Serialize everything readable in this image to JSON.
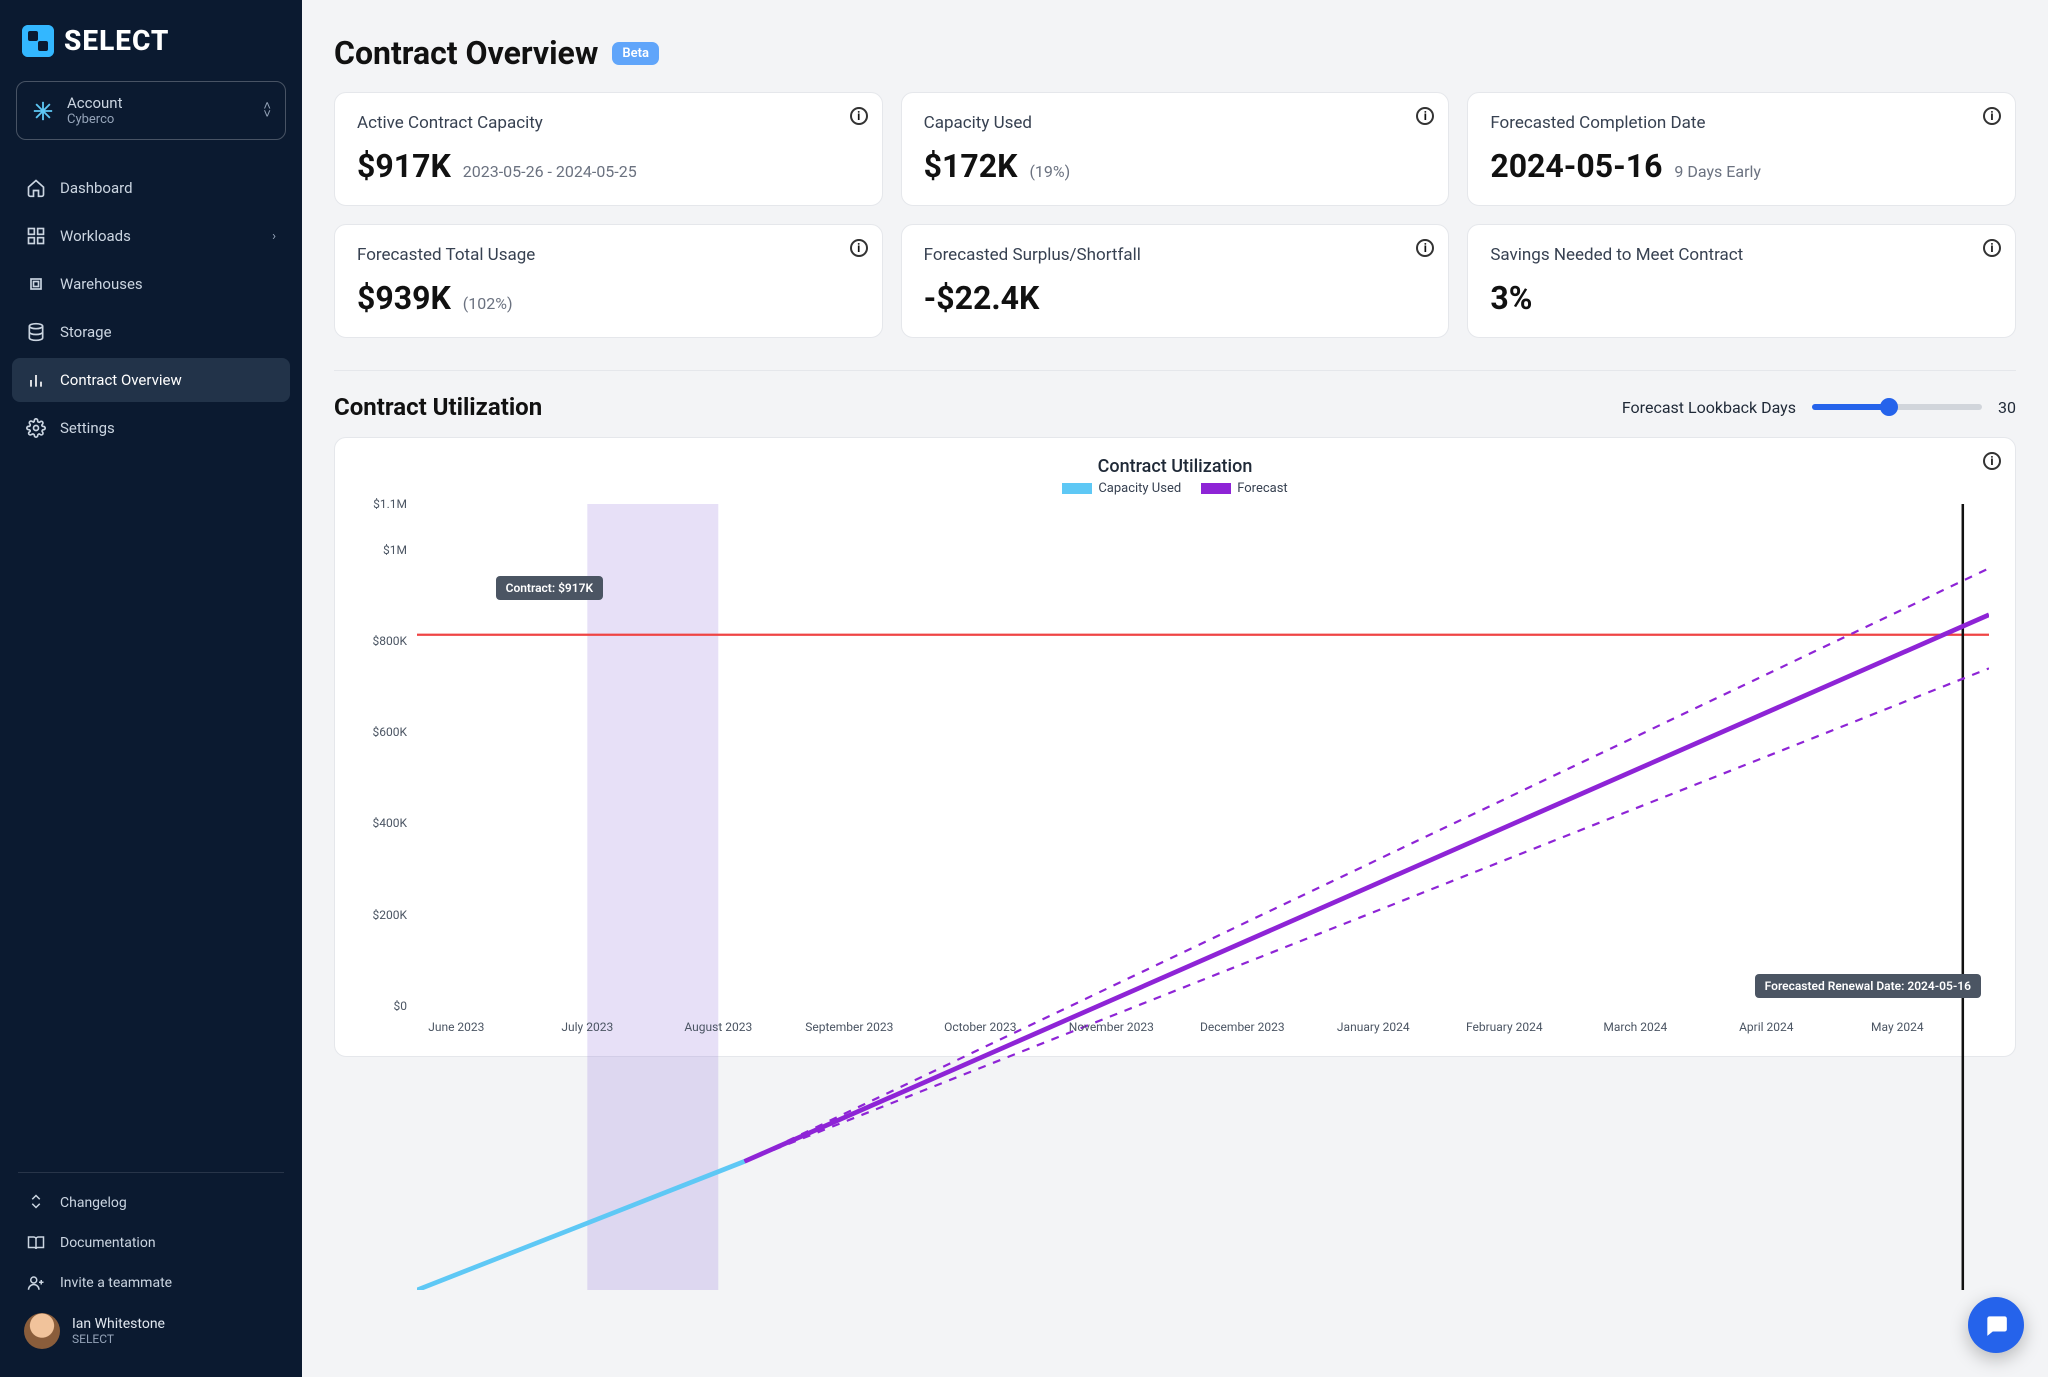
{
  "brand": "SELECT",
  "account": {
    "label": "Account",
    "name": "Cyberco"
  },
  "nav": {
    "dashboard": "Dashboard",
    "workloads": "Workloads",
    "warehouses": "Warehouses",
    "storage": "Storage",
    "contract_overview": "Contract Overview",
    "settings": "Settings"
  },
  "bottom_nav": {
    "changelog": "Changelog",
    "documentation": "Documentation",
    "invite": "Invite a teammate"
  },
  "user": {
    "name": "Ian Whitestone",
    "org": "SELECT"
  },
  "page": {
    "title": "Contract Overview",
    "badge": "Beta"
  },
  "cards": {
    "active_capacity": {
      "title": "Active Contract Capacity",
      "value": "$917K",
      "sub": "2023-05-26 - 2024-05-25"
    },
    "capacity_used": {
      "title": "Capacity Used",
      "value": "$172K",
      "sub": "(19%)"
    },
    "forecasted_completion": {
      "title": "Forecasted Completion Date",
      "value": "2024-05-16",
      "sub": "9 Days Early"
    },
    "forecasted_total": {
      "title": "Forecasted Total Usage",
      "value": "$939K",
      "sub": "(102%)"
    },
    "surplus": {
      "title": "Forecasted Surplus/Shortfall",
      "value": "-$22.4K"
    },
    "savings": {
      "title": "Savings Needed to Meet Contract",
      "value": "3%"
    }
  },
  "utilization": {
    "title": "Contract Utilization",
    "lookback_label": "Forecast Lookback Days",
    "lookback_value": "30"
  },
  "chart": {
    "title": "Contract Utilization",
    "legend": {
      "used": "Capacity Used",
      "forecast": "Forecast"
    },
    "contract_badge": "Contract: $917K",
    "renewal_badge": "Forecasted Renewal Date: 2024-05-16"
  },
  "chart_data": {
    "type": "line",
    "ylabel": "",
    "xlabel": "",
    "ylim": [
      0,
      1100000
    ],
    "y_ticks": [
      "$0",
      "$200K",
      "$400K",
      "$600K",
      "$800K",
      "$1M",
      "$1.1M"
    ],
    "y_tick_values": [
      0,
      200000,
      400000,
      600000,
      800000,
      1000000,
      1100000
    ],
    "x_ticks": [
      "June 2023",
      "July 2023",
      "August 2023",
      "September 2023",
      "October 2023",
      "November 2023",
      "December 2023",
      "January 2024",
      "February 2024",
      "March 2024",
      "April 2024",
      "May 2024"
    ],
    "x_tick_index": [
      0,
      1,
      2,
      3,
      4,
      5,
      6,
      7,
      8,
      9,
      10,
      11
    ],
    "x_range": [
      -0.3,
      11.7
    ],
    "contract_value": 917000,
    "renewal_x": 11.5,
    "shade_x": [
      1,
      2
    ],
    "series": [
      {
        "name": "Capacity Used",
        "color": "#5ec8f5",
        "points": [
          [
            -0.3,
            0
          ],
          [
            2.2,
            180000
          ]
        ]
      },
      {
        "name": "Forecast",
        "color": "#8e24d6",
        "points": [
          [
            2.2,
            180000
          ],
          [
            11.7,
            945000
          ]
        ]
      },
      {
        "name": "Forecast Upper",
        "color": "#8e24d6",
        "dashed": true,
        "points": [
          [
            2.2,
            180000
          ],
          [
            11.7,
            1010000
          ]
        ]
      },
      {
        "name": "Forecast Lower",
        "color": "#8e24d6",
        "dashed": true,
        "points": [
          [
            2.2,
            180000
          ],
          [
            11.7,
            870000
          ]
        ]
      }
    ]
  },
  "colors": {
    "used": "#5ec8f5",
    "forecast": "#8e24d6",
    "contract": "#ef4444"
  }
}
